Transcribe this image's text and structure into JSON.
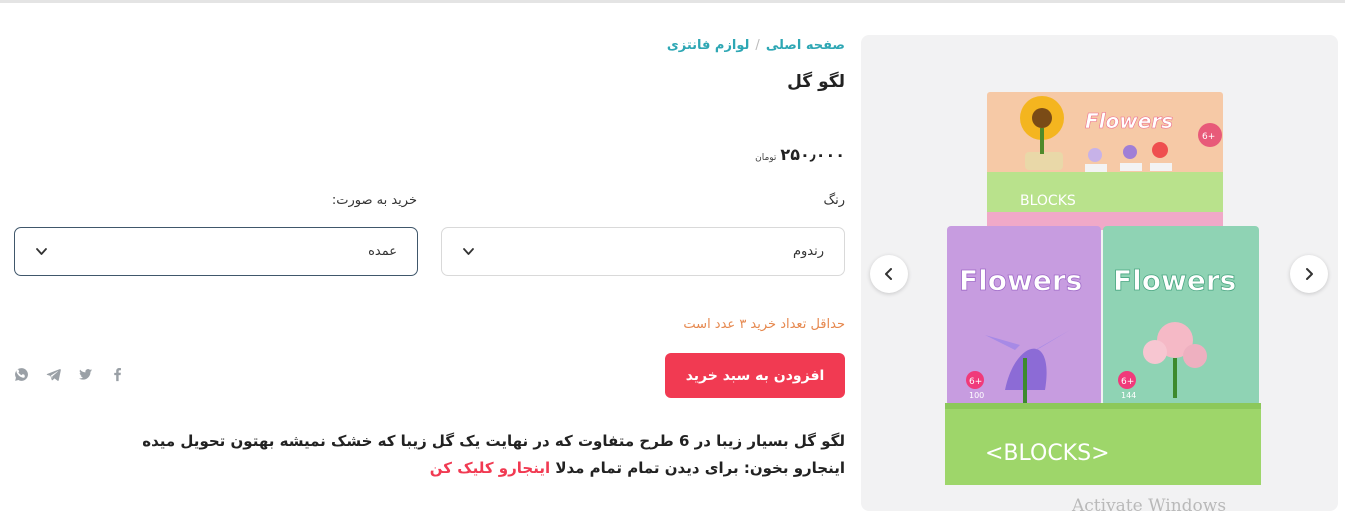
{
  "breadcrumb": {
    "home": "صفحه اصلی",
    "category": "لوازم فانتزی",
    "separator": "/"
  },
  "product": {
    "title": "لگو گل",
    "price": "۲۵۰٫۰۰۰",
    "currency": "تومان"
  },
  "options": {
    "color_label": "رنگ",
    "color_value": "رندوم",
    "mode_label": "خرید به صورت:",
    "mode_value": "عمده"
  },
  "min_note": "حداقل تعداد خرید ۳ عدد است",
  "add_to_cart": "افزودن به سبد خرید",
  "description": {
    "text": "لگو گل بسیار زیبا در 6 طرح متفاوت که در نهایت یک گل زیبا که خشک نمیشه بهتون تحویل میده اینجارو بخون: برای دیدن تمام تمام مدلا ",
    "link": "اینجارو کلیک کن"
  },
  "image_text": {
    "top": "Flowers",
    "left_box": "Flowers",
    "right_box": "Flowers",
    "blocks_bottom": "<BLOCKS>",
    "blocks_top": "BLOCKS",
    "badge_left": "6+",
    "badge_right": "6+",
    "count_left": "100",
    "count_right": "144"
  },
  "social_icons": [
    "facebook-icon",
    "twitter-icon",
    "telegram-icon",
    "whatsapp-icon"
  ],
  "watermark": "Activate Windows",
  "colors": {
    "accent": "#f13a52",
    "link_teal": "#2ea7b4",
    "note_orange": "#e6884e"
  }
}
